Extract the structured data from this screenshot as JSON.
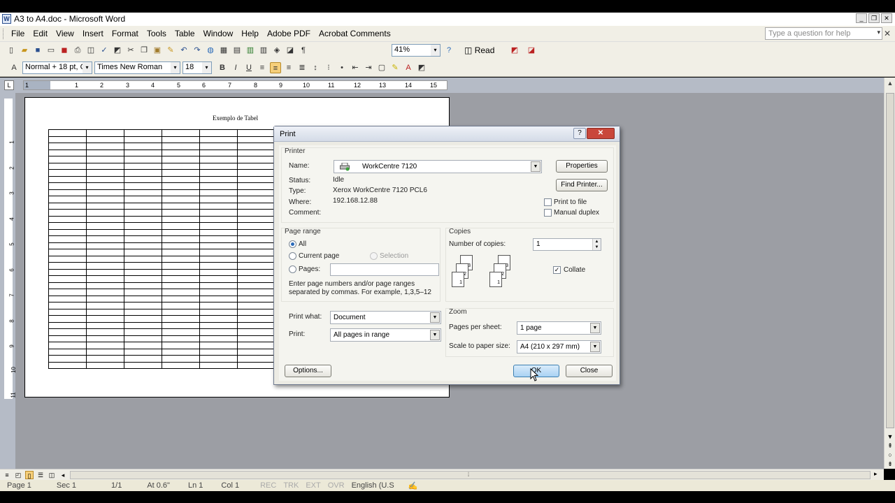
{
  "window": {
    "title": "A3 to A4.doc - Microsoft Word"
  },
  "menubar": {
    "items": [
      "File",
      "Edit",
      "View",
      "Insert",
      "Format",
      "Tools",
      "Table",
      "Window",
      "Help",
      "Adobe PDF",
      "Acrobat Comments"
    ],
    "help_placeholder": "Type a question for help"
  },
  "toolbar": {
    "zoom": "41%",
    "read_label": "Read"
  },
  "formatting": {
    "style": "Normal + 18 pt, C",
    "font": "Times New Roman",
    "size": "18"
  },
  "ruler": {
    "h_numbers": [
      "1",
      "1",
      "2",
      "3",
      "4",
      "5",
      "6",
      "7",
      "8",
      "9",
      "10",
      "11",
      "12",
      "13",
      "14",
      "15"
    ],
    "v_numbers": [
      "1",
      "2",
      "3",
      "4",
      "5",
      "6",
      "7",
      "8",
      "9",
      "10",
      "11"
    ]
  },
  "document": {
    "heading": "Exemplo de Tabel",
    "table_rows": 36,
    "table_cols": 8
  },
  "dialog": {
    "title": "Print",
    "printer": {
      "group_label": "Printer",
      "name_label": "Name:",
      "name_value": "WorkCentre 7120",
      "status_label": "Status:",
      "status_value": "Idle",
      "type_label": "Type:",
      "type_value": "Xerox WorkCentre 7120 PCL6",
      "where_label": "Where:",
      "where_value": "192.168.12.88",
      "comment_label": "Comment:",
      "properties_btn": "Properties",
      "find_btn": "Find Printer...",
      "print_to_file": "Print to file",
      "manual_duplex": "Manual duplex"
    },
    "page_range": {
      "group_label": "Page range",
      "all": "All",
      "current_page": "Current page",
      "selection": "Selection",
      "pages": "Pages:",
      "hint": "Enter page numbers and/or page ranges separated by commas.  For example, 1,3,5–12"
    },
    "copies": {
      "group_label": "Copies",
      "number_label": "Number of copies:",
      "number_value": "1",
      "collate": "Collate",
      "sheet_numbers": [
        "3",
        "2",
        "1"
      ]
    },
    "print_what": {
      "label": "Print what:",
      "value": "Document"
    },
    "print": {
      "label": "Print:",
      "value": "All pages in range"
    },
    "zoom": {
      "group_label": "Zoom",
      "pages_per_sheet_label": "Pages per sheet:",
      "pages_per_sheet_value": "1 page",
      "scale_label": "Scale to paper size:",
      "scale_value": "A4 (210 x 297 mm)"
    },
    "options_btn": "Options...",
    "ok_btn": "OK",
    "close_btn": "Close"
  },
  "statusbar": {
    "page": "Page 1",
    "sec": "Sec 1",
    "pages": "1/1",
    "at": "At 0.6\"",
    "ln": "Ln 1",
    "col": "Col 1",
    "rec": "REC",
    "trk": "TRK",
    "ext": "EXT",
    "ovr": "OVR",
    "lang": "English (U.S"
  }
}
